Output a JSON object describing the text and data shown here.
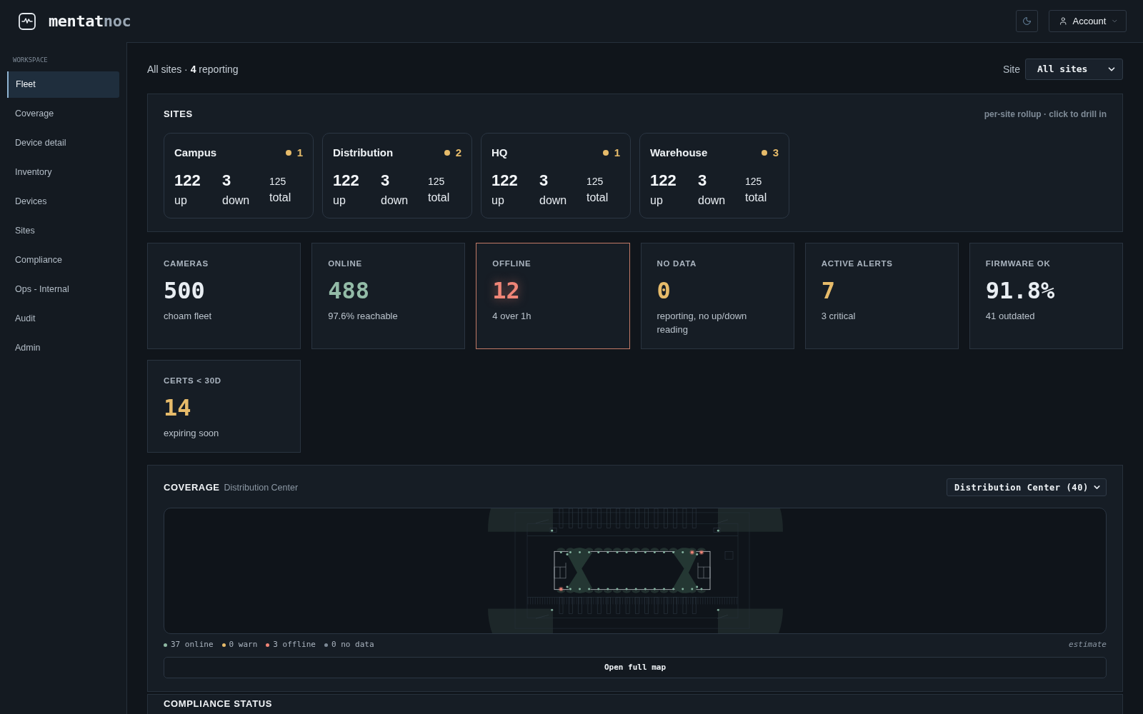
{
  "header": {
    "brand": {
      "name": "mentat",
      "accent": "noc"
    },
    "account_button": {
      "label": "Account"
    }
  },
  "sidebar": {
    "section": "WORKSPACE",
    "items": [
      {
        "label": "Fleet",
        "selected": true
      },
      {
        "label": "Coverage",
        "selected": false
      },
      {
        "label": "Device detail",
        "selected": false
      },
      {
        "label": "Inventory",
        "selected": false
      },
      {
        "label": "Devices",
        "selected": false
      },
      {
        "label": "Sites",
        "selected": false
      },
      {
        "label": "Compliance",
        "selected": false
      },
      {
        "label": "Ops - Internal",
        "selected": false
      },
      {
        "label": "Audit",
        "selected": false
      },
      {
        "label": "Admin",
        "selected": false
      }
    ]
  },
  "page": {
    "summary": "All sites · **4** reporting",
    "site_filter": {
      "label": "Site",
      "value": "All sites"
    }
  },
  "sites_panel": {
    "title": "SITES",
    "note": "per-site rollup · click to drill in",
    "sites": [
      {
        "name": "Campus",
        "alerts": "1",
        "up": "122",
        "up_label": "up",
        "down": "3",
        "down_label": "down",
        "total": "125",
        "total_label": "total"
      },
      {
        "name": "Distribution",
        "alerts": "2",
        "up": "122",
        "up_label": "up",
        "down": "3",
        "down_label": "down",
        "total": "125",
        "total_label": "total"
      },
      {
        "name": "HQ",
        "alerts": "1",
        "up": "122",
        "up_label": "up",
        "down": "3",
        "down_label": "down",
        "total": "125",
        "total_label": "total"
      },
      {
        "name": "Warehouse",
        "alerts": "3",
        "up": "122",
        "up_label": "up",
        "down": "3",
        "down_label": "down",
        "total": "125",
        "total_label": "total"
      }
    ]
  },
  "stats": [
    {
      "label": "CAMERAS",
      "value": "500",
      "note": "choam fleet",
      "color": "#e8edf2",
      "highlighted": false
    },
    {
      "label": "ONLINE",
      "value": "488",
      "note": "97.6% reachable",
      "color": "#93bba7",
      "highlighted": false
    },
    {
      "label": "OFFLINE",
      "value": "12",
      "note": "4 over 1h",
      "color": "#ef8577",
      "highlighted": true
    },
    {
      "label": "NO DATA",
      "value": "0",
      "note": "reporting, no up/down reading",
      "color": "#e6bb6a",
      "highlighted": false
    },
    {
      "label": "ACTIVE ALERTS",
      "value": "7",
      "note": "3 critical",
      "color": "#e6bb6a",
      "highlighted": false
    },
    {
      "label": "FIRMWARE OK",
      "value": "91.8%",
      "note": "41 outdated",
      "color": "#e8edf2",
      "highlighted": false
    },
    {
      "label": "CERTS < 30D",
      "value": "14",
      "note": "expiring soon",
      "color": "#e6bb6a",
      "highlighted": false
    }
  ],
  "coverage": {
    "title": "COVERAGE",
    "subtitle": "Distribution Center",
    "site_select": {
      "value": "Distribution Center (40)"
    },
    "cameras": [
      {
        "online": true
      },
      {
        "online": true
      },
      {
        "online": true
      },
      {
        "online": true
      },
      {
        "online": true
      },
      {
        "online": true
      },
      {
        "online": true
      },
      {
        "online": true
      },
      {
        "online": true
      },
      {
        "online": true
      },
      {
        "online": true
      },
      {
        "online": true
      },
      {
        "online": true
      },
      {
        "online": true
      },
      {
        "online": false
      },
      {
        "online": false
      },
      {
        "online": false
      },
      {
        "online": true
      },
      {
        "online": true
      },
      {
        "online": true
      },
      {
        "online": true
      },
      {
        "online": true
      },
      {
        "online": true
      },
      {
        "online": true
      },
      {
        "online": true
      },
      {
        "online": true
      },
      {
        "online": true
      },
      {
        "online": true
      },
      {
        "online": true
      },
      {
        "online": true
      },
      {
        "online": true
      },
      {
        "online": true
      },
      {
        "online": true
      },
      {
        "online": true
      },
      {
        "online": true
      },
      {
        "online": true
      },
      {
        "online": true
      },
      {
        "online": true
      },
      {
        "online": true
      },
      {
        "online": true
      }
    ],
    "legend": [
      {
        "label": "37 online",
        "color": "#8fb9a3"
      },
      {
        "label": "0 warn",
        "color": "#e6bb6a"
      },
      {
        "label": "3 offline",
        "color": "#ef8577"
      },
      {
        "label": "0 no data",
        "color": "#7d8a96"
      }
    ],
    "note": "estimate",
    "open_button": "Open full map"
  },
  "compliance": {
    "title": "COMPLIANCE STATUS"
  }
}
